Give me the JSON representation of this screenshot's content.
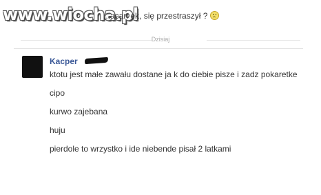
{
  "watermark": "www.wiocha.pl",
  "previous_message": {
    "text": "...acan ek, się przestraszył ?",
    "emoticon": "frown-icon"
  },
  "divider": {
    "label": "Dzisiaj"
  },
  "thread": {
    "sender": "Kacper",
    "messages": [
      "ktotu jest małe zawału dostane ja k do ciebie pisze i zadz pokaretke",
      "cipo",
      "kurwo zajebana",
      "huju",
      "pierdole to wrzystko i ide niebende pisał 2 latkami"
    ]
  },
  "colors": {
    "sender_link": "#3b5998",
    "text": "#333333",
    "divider_line": "#e6e6e6"
  }
}
